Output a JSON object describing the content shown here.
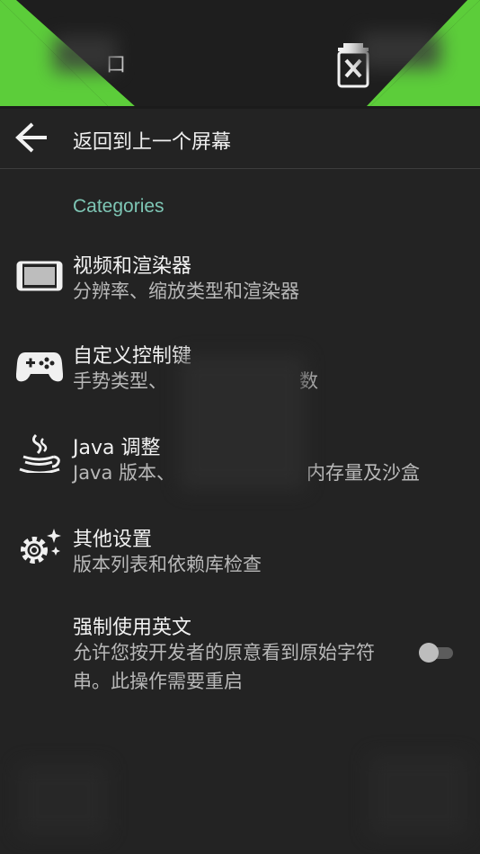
{
  "top_banner": {
    "title": "口",
    "accent_color": "#5ccd3a"
  },
  "back": {
    "label": "返回到上一个屏幕"
  },
  "section": {
    "header": "Categories"
  },
  "items": [
    {
      "title": "视频和渲染器",
      "summary": "分辨率、缩放类型和渲染器",
      "icon": "screen-icon"
    },
    {
      "title": "自定义控制键",
      "summary_left": "手势类型、",
      "summary_right": "数",
      "icon": "gamepad-icon"
    },
    {
      "title": "Java 调整",
      "summary_left": "Java 版本、",
      "summary_right": "内存量及沙盒",
      "icon": "java-cup-icon"
    },
    {
      "title": "其他设置",
      "summary": "版本列表和依赖库检查",
      "icon": "gear-sparkle-icon"
    },
    {
      "title": "强制使用英文",
      "summary": "允许您按开发者的原意看到原始字符串。此操作需要重启",
      "toggle": false
    }
  ]
}
